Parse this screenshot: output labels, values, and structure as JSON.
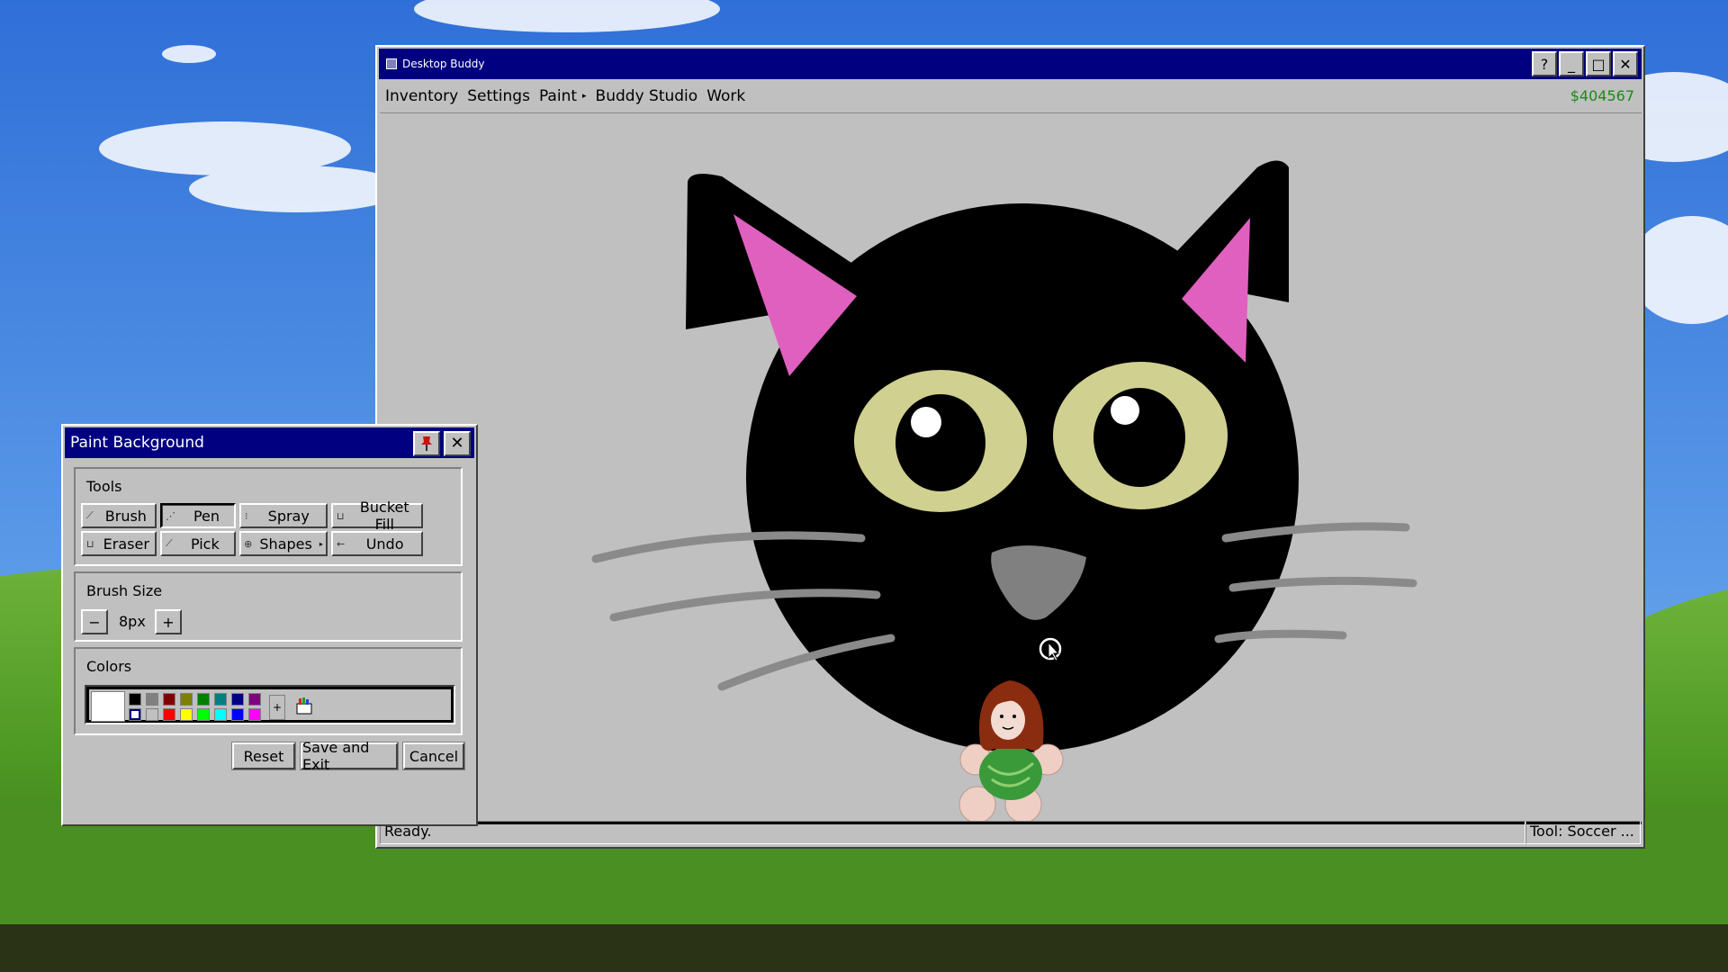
{
  "window": {
    "title": "Desktop Buddy",
    "buttons": {
      "help": "?",
      "minimize": "_",
      "maximize": "□",
      "close": "✕"
    }
  },
  "menu": {
    "items": [
      "Inventory",
      "Settings",
      "Paint",
      "Buddy Studio",
      "Work"
    ],
    "paint_arrow": "▸",
    "money": "$404567"
  },
  "status": {
    "left": "Ready.",
    "right": "Tool: Soccer ..."
  },
  "dialog": {
    "title": "Paint Background",
    "pin_icon": "pin-icon",
    "close_label": "✕",
    "tools_label": "Tools",
    "tools": [
      {
        "label": "Brush",
        "icon": "⟋"
      },
      {
        "label": "Pen",
        "icon": "⋰",
        "active": true
      },
      {
        "label": "Spray",
        "icon": "⁝"
      },
      {
        "label": "Bucket Fill",
        "icon": "⊔"
      },
      {
        "label": "Eraser",
        "icon": "⊔"
      },
      {
        "label": "Pick",
        "icon": "⟋"
      },
      {
        "label": "Shapes",
        "icon": "⊕",
        "sub": "▸"
      },
      {
        "label": "Undo",
        "icon": "←"
      }
    ],
    "brush_size_label": "Brush Size",
    "brush_size_value": "8px",
    "minus_label": "−",
    "plus_label": "+",
    "colors_label": "Colors",
    "current_color": "#ffffff",
    "palette_top": [
      "#000000",
      "#808080",
      "#800000",
      "#808000",
      "#008000",
      "#008080",
      "#000080",
      "#800080"
    ],
    "palette_bottom": [
      "#ffffff",
      "#c0c0c0",
      "#ff0000",
      "#ffff00",
      "#00ff00",
      "#00ffff",
      "#0000ff",
      "#ff00ff"
    ],
    "palette_plus": "+",
    "reset_label": "Reset",
    "save_label": "Save and Exit",
    "cancel_label": "Cancel"
  },
  "colors": {
    "title_bar": "#000080",
    "money": "#1a8a1a",
    "cat_body": "#000000",
    "cat_ear_inner": "#e060c0",
    "cat_iris": "#d0d090",
    "cat_nose": "#808080",
    "whiskers": "#8a8a8a"
  }
}
